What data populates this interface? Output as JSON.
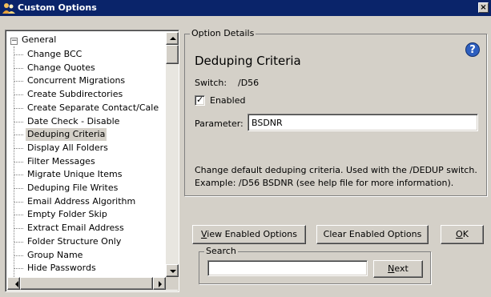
{
  "window": {
    "title": "Custom Options",
    "close_glyph": "×"
  },
  "tree": {
    "root_label": "General",
    "expander": "−",
    "items": [
      "Change BCC",
      "Change Quotes",
      "Concurrent Migrations",
      "Create Subdirectories",
      "Create Separate Contact/Cale",
      "Date Check - Disable",
      "Deduping Criteria",
      "Display All Folders",
      "Filter Messages",
      "Migrate Unique Items",
      "Deduping File Writes",
      "Email Address Algorithm",
      "Empty Folder Skip",
      "Extract Email Address",
      "Folder Structure Only",
      "Group Name",
      "Hide Passwords"
    ],
    "selected": "Deduping Criteria"
  },
  "details": {
    "legend": "Option Details",
    "title": "Deduping Criteria",
    "help_glyph": "?",
    "switch_label": "Switch:",
    "switch_value": "/D56",
    "enabled_label": "Enabled",
    "enabled_checked": true,
    "check_glyph": "✓",
    "parameter_label": "Parameter:",
    "parameter_value": "BSDNR",
    "description_1": "Change default deduping criteria. Used with the /DEDUP switch.",
    "description_2": "Example: /D56 BSDNR (see help file for more information)."
  },
  "buttons": {
    "view_key": "V",
    "view_rest": "iew Enabled Options",
    "clear": "Clear Enabled Options",
    "ok_key": "O",
    "ok_rest": "K"
  },
  "search": {
    "legend": "Search",
    "value": "",
    "next_key": "N",
    "next_rest": "ext"
  },
  "colors": {
    "titlebar": "#0a246a",
    "dialog": "#d4d0c8",
    "selection": "#d4d0c8",
    "help": "#2e5fbf"
  }
}
